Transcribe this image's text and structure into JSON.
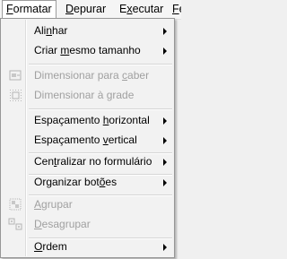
{
  "menubar": {
    "items": [
      {
        "pre": "",
        "accel": "F",
        "post": "ormatar"
      },
      {
        "pre": "",
        "accel": "D",
        "post": "epurar"
      },
      {
        "pre": "E",
        "accel": "x",
        "post": "ecutar"
      },
      {
        "pre": "",
        "accel": "F",
        "post": "e"
      }
    ]
  },
  "menu": {
    "items": [
      {
        "pre": "Ali",
        "accel": "n",
        "post": "har"
      },
      {
        "pre": "Criar ",
        "accel": "m",
        "post": "esmo tamanho"
      },
      {
        "pre": "Dimensionar para ",
        "accel": "c",
        "post": "aber"
      },
      {
        "pre": "Dimensionar à ",
        "accel": "g",
        "post": "rade"
      },
      {
        "pre": "Espaçamento ",
        "accel": "h",
        "post": "orizontal"
      },
      {
        "pre": "Espaçamento ",
        "accel": "v",
        "post": "ertical"
      },
      {
        "pre": "Cen",
        "accel": "t",
        "post": "ralizar no formulário"
      },
      {
        "pre": "Organizar bot",
        "accel": "õ",
        "post": "es"
      },
      {
        "pre": "",
        "accel": "A",
        "post": "grupar"
      },
      {
        "pre": "",
        "accel": "D",
        "post": "esagrupar"
      },
      {
        "pre": "",
        "accel": "O",
        "post": "rdem"
      }
    ]
  },
  "colors": {
    "disabled_text": "#a0a0a0",
    "menu_bg": "#f2f2f2",
    "border": "#979797"
  }
}
